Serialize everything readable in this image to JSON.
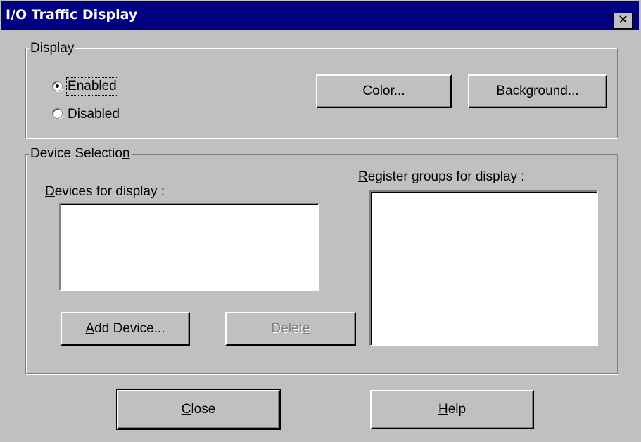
{
  "window": {
    "title": "I/O Traffic Display",
    "close_glyph": "✕"
  },
  "display_group": {
    "legend_pre": "Dis",
    "legend_key": "p",
    "legend_post": "lay",
    "enabled": {
      "key": "E",
      "rest": "nabled",
      "selected": true
    },
    "disabled": {
      "label": "Disabled",
      "selected": false
    },
    "color_button": {
      "pre": "C",
      "key": "o",
      "post": "lor..."
    },
    "background_button": {
      "key": "B",
      "rest": "ackground..."
    }
  },
  "device_group": {
    "legend_pre": "Device Selectio",
    "legend_key": "n",
    "devices_label": {
      "key": "D",
      "rest": "evices for display :"
    },
    "registers_label": {
      "key": "R",
      "rest": "egister groups for display :"
    },
    "devices_items": [],
    "registers_items": [],
    "add_button": {
      "key": "A",
      "rest": "dd Device..."
    },
    "delete_button": {
      "pre": "Delet",
      "key": "e",
      "enabled": false
    }
  },
  "footer": {
    "close_button": {
      "key": "C",
      "rest": "lose"
    },
    "help_button": {
      "key": "H",
      "rest": "elp"
    }
  },
  "colors": {
    "titlebar": "#000080",
    "face": "#c0c0c0"
  },
  "icons": [
    "close-icon",
    "radio-selected-icon",
    "radio-unselected-icon"
  ]
}
